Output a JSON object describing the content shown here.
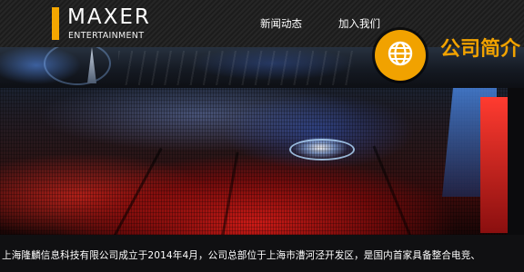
{
  "brand": {
    "name": "MAXER",
    "subtitle": "ENTERTAINMENT",
    "accent_color": "#f5a700"
  },
  "nav": {
    "items": [
      {
        "label": "新闻动态"
      },
      {
        "label": "加入我们"
      }
    ]
  },
  "section": {
    "title": "公司简介",
    "badge_icon": "globe-icon",
    "badge_color": "#f1a200"
  },
  "intro": {
    "text": "上海隆麟信息科技有限公司成立于2014年4月，公司总部位于上海市漕河泾开发区，是国内首家具备整合电竞、"
  }
}
